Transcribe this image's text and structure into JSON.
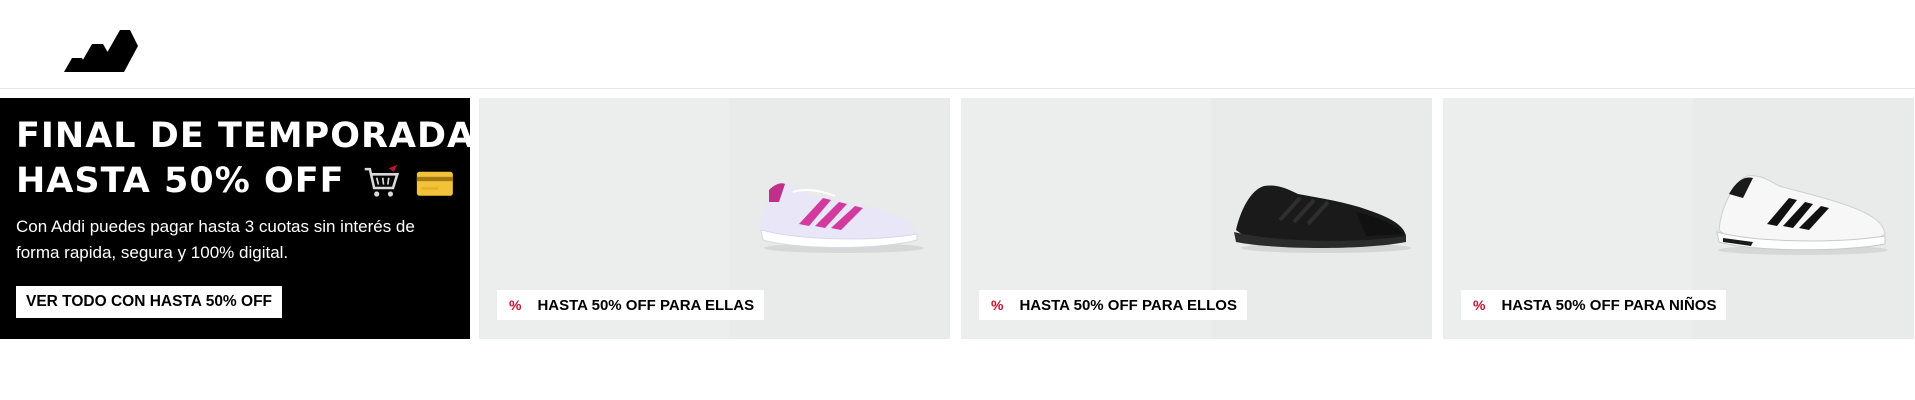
{
  "header": {
    "logo_icon": "adidas-logo"
  },
  "hero": {
    "title_line1": "FINAL DE TEMPORADA:",
    "title_line2": "HASTA 50% OFF",
    "cart_icon": "shopping-cart-icon",
    "card_icon": "credit-card-icon",
    "description": "Con Addi puedes pagar hasta 3 cuotas sin interés de forma rapida, segura y 100% digital.",
    "cta_label": "VER TODO CON HASTA 50% OFF"
  },
  "promos": [
    {
      "percent_symbol": "%",
      "label": "HASTA 50% OFF PARA ELLAS",
      "image": "white-pink-running-shoe"
    },
    {
      "percent_symbol": "%",
      "label": "HASTA 50% OFF PARA ELLOS",
      "image": "black-sneaker"
    },
    {
      "percent_symbol": "%",
      "label": "HASTA 50% OFF PARA NIÑOS",
      "image": "white-black-stripes-sneaker"
    }
  ],
  "colors": {
    "hero_background": "#000000",
    "promo_background": "#eceeee",
    "percent_accent": "#c8102e"
  }
}
